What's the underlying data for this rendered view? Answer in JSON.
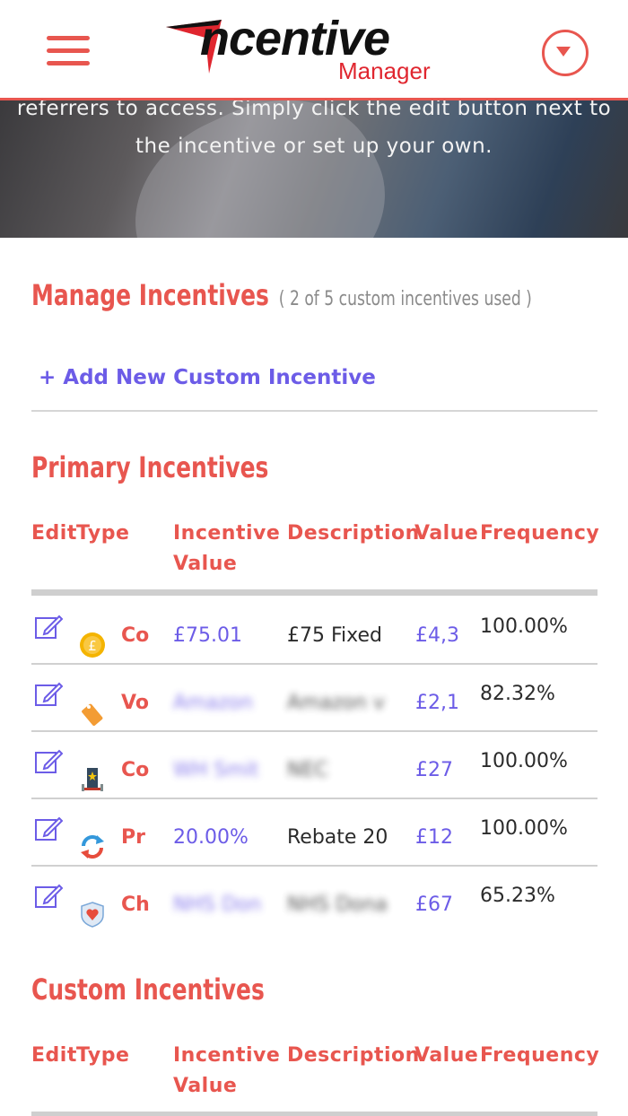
{
  "header": {
    "logo_word": "ncentive",
    "logo_sub": "Manager",
    "brand_color": "#e8564f",
    "menu_icon": "hamburger-icon",
    "dropdown_icon": "caret-down-circle-icon"
  },
  "hero": {
    "text": "referrers to access. Simply click the edit button next to the incentive or set up your own."
  },
  "manage": {
    "title": "Manage Incentives",
    "usage": "( 2 of 5 custom incentives used )",
    "add_link": "+ Add New Custom Incentive"
  },
  "table_headers": {
    "edit": "Edit",
    "type": "Type",
    "incentive_value_1": "Incentive",
    "incentive_value_2": "Value",
    "description": "Description",
    "value": "Value",
    "frequency": "Frequency"
  },
  "primary": {
    "title": "Primary Incentives",
    "rows": [
      {
        "icon": "coin-icon",
        "type": "Co",
        "incentive_value": "£75.01",
        "description": "£75 Fixed",
        "value": "£4,3",
        "frequency": "100.00%"
      },
      {
        "icon": "voucher-icon",
        "type": "Vo",
        "incentive_value": "Amazon",
        "description": "Amazon v",
        "value": "£2,1",
        "frequency": "82.32%"
      },
      {
        "icon": "concert-ticket-icon",
        "type": "Co",
        "incentive_value": "WH Smit",
        "description": "NEC",
        "value": "£27",
        "frequency": "100.00%"
      },
      {
        "icon": "refresh-arrows-icon",
        "type": "Pr",
        "incentive_value": "20.00%",
        "description": "Rebate 20",
        "value": "£12",
        "frequency": "100.00%"
      },
      {
        "icon": "charity-heart-icon",
        "type": "Ch",
        "incentive_value": "NHS Don",
        "description": "NHS Dona",
        "value": "£67",
        "frequency": "65.23%"
      }
    ]
  },
  "custom": {
    "title": "Custom Incentives"
  }
}
